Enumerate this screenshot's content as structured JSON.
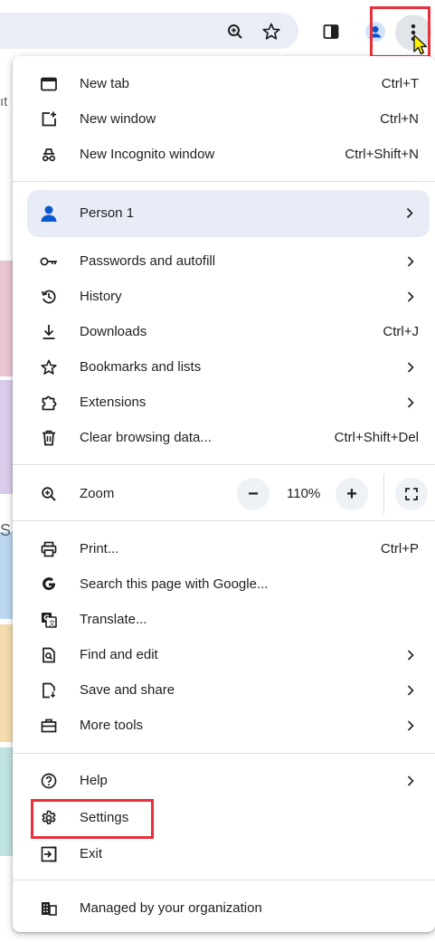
{
  "toolbar": {
    "zoom_icon": "zoom-in-icon",
    "bookmark_icon": "star-icon",
    "side_panel_icon": "side-panel-icon",
    "profile_icon": "profile-icon",
    "menu_icon": "more-vert-icon"
  },
  "background": {
    "fragment_1": "ıt",
    "fragment_2": "S"
  },
  "menu": {
    "new_tab": {
      "label": "New tab",
      "shortcut": "Ctrl+T",
      "icon": "new-tab-icon"
    },
    "new_window": {
      "label": "New window",
      "shortcut": "Ctrl+N",
      "icon": "new-window-icon"
    },
    "incognito": {
      "label": "New Incognito window",
      "shortcut": "Ctrl+Shift+N",
      "icon": "incognito-icon"
    },
    "profile": {
      "label": "Person 1",
      "icon": "person-icon"
    },
    "passwords": {
      "label": "Passwords and autofill",
      "icon": "key-icon"
    },
    "history": {
      "label": "History",
      "icon": "history-icon"
    },
    "downloads": {
      "label": "Downloads",
      "shortcut": "Ctrl+J",
      "icon": "download-icon"
    },
    "bookmarks": {
      "label": "Bookmarks and lists",
      "icon": "star-icon"
    },
    "extensions": {
      "label": "Extensions",
      "icon": "extension-icon"
    },
    "clear_data": {
      "label": "Clear browsing data...",
      "shortcut": "Ctrl+Shift+Del",
      "icon": "trash-icon"
    },
    "zoom": {
      "label": "Zoom",
      "value": "110%",
      "minus": "−",
      "plus": "+",
      "icon": "zoom-icon",
      "fullscreen_icon": "fullscreen-icon"
    },
    "print": {
      "label": "Print...",
      "shortcut": "Ctrl+P",
      "icon": "printer-icon"
    },
    "search_google": {
      "label": "Search this page with Google...",
      "icon": "google-icon"
    },
    "translate": {
      "label": "Translate...",
      "icon": "translate-icon"
    },
    "find_edit": {
      "label": "Find and edit",
      "icon": "find-icon"
    },
    "save_share": {
      "label": "Save and share",
      "icon": "save-share-icon"
    },
    "more_tools": {
      "label": "More tools",
      "icon": "toolbox-icon"
    },
    "help": {
      "label": "Help",
      "icon": "help-icon"
    },
    "settings": {
      "label": "Settings",
      "icon": "gear-icon"
    },
    "exit": {
      "label": "Exit",
      "icon": "exit-icon"
    },
    "managed": {
      "label": "Managed by your organization",
      "icon": "building-icon"
    }
  },
  "colors": {
    "highlight": "#e8303a",
    "profile_bg": "#e7ecf7",
    "accent_blue": "#0b57d0"
  }
}
